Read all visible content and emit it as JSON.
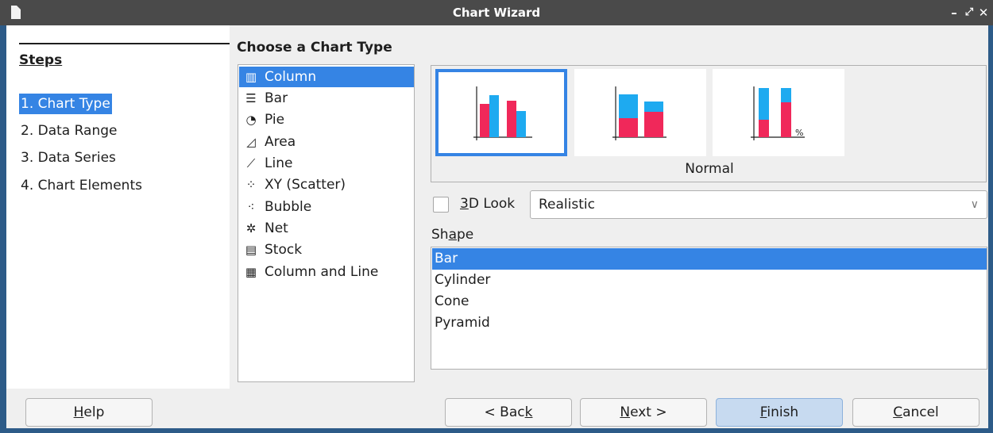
{
  "window": {
    "title": "Chart Wizard",
    "controls": {
      "minimize": "–",
      "maximize": "⤢",
      "close": "✕"
    }
  },
  "steps": {
    "heading": "Steps",
    "items": [
      {
        "label": "1. Chart Type",
        "active": true
      },
      {
        "label": "2. Data Range",
        "active": false
      },
      {
        "label": "3. Data Series",
        "active": false
      },
      {
        "label": "4. Chart Elements",
        "active": false
      }
    ]
  },
  "chart_type_section": {
    "heading": "Choose a Chart Type",
    "types": [
      {
        "label": "Column",
        "icon": "column-chart-icon",
        "selected": true
      },
      {
        "label": "Bar",
        "icon": "bar-chart-icon",
        "selected": false
      },
      {
        "label": "Pie",
        "icon": "pie-chart-icon",
        "selected": false
      },
      {
        "label": "Area",
        "icon": "area-chart-icon",
        "selected": false
      },
      {
        "label": "Line",
        "icon": "line-chart-icon",
        "selected": false
      },
      {
        "label": "XY (Scatter)",
        "icon": "scatter-chart-icon",
        "selected": false
      },
      {
        "label": "Bubble",
        "icon": "bubble-chart-icon",
        "selected": false
      },
      {
        "label": "Net",
        "icon": "net-chart-icon",
        "selected": false
      },
      {
        "label": "Stock",
        "icon": "stock-chart-icon",
        "selected": false
      },
      {
        "label": "Column and Line",
        "icon": "column-line-chart-icon",
        "selected": false
      }
    ]
  },
  "variants": {
    "selected_label": "Normal",
    "percent_mark": "%",
    "items": [
      {
        "name": "normal",
        "selected": true
      },
      {
        "name": "stacked",
        "selected": false
      },
      {
        "name": "percent-stacked",
        "selected": false
      }
    ]
  },
  "look": {
    "checkbox_label_prefix": "",
    "checkbox_label_mnemonic": "3",
    "checkbox_label_rest": "D Look",
    "checked": false,
    "select_value": "Realistic"
  },
  "shape": {
    "label_prefix": "Sh",
    "label_mnemonic": "a",
    "label_rest": "pe",
    "items": [
      {
        "label": "Bar",
        "selected": true
      },
      {
        "label": "Cylinder",
        "selected": false
      },
      {
        "label": "Cone",
        "selected": false
      },
      {
        "label": "Pyramid",
        "selected": false
      }
    ]
  },
  "buttons": {
    "help": {
      "mnemonic": "H",
      "rest": "elp"
    },
    "back": {
      "prefix": "< Bac",
      "mnemonic": "k",
      "rest": ""
    },
    "next": {
      "prefix": "",
      "mnemonic": "N",
      "rest": "ext >"
    },
    "finish": {
      "prefix": "",
      "mnemonic": "F",
      "rest": "inish"
    },
    "cancel": {
      "prefix": "",
      "mnemonic": "C",
      "rest": "ancel"
    }
  },
  "colors": {
    "accent": "#3584e4",
    "series_a": "#f0285a",
    "series_b": "#1eaaf0"
  }
}
